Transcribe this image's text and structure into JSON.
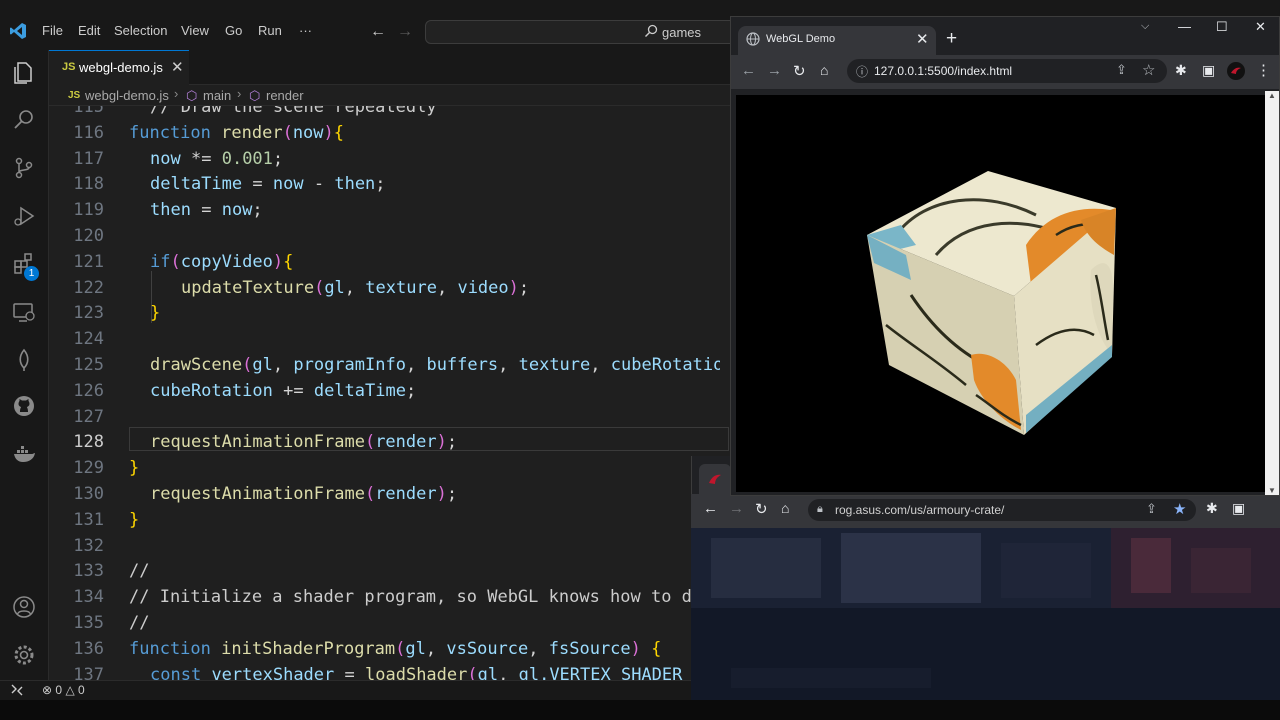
{
  "vscode": {
    "menu": [
      "File",
      "Edit",
      "Selection",
      "View",
      "Go",
      "Run",
      "···"
    ],
    "command_center": "games",
    "tab": {
      "icon_text": "JS",
      "label": "webgl-demo.js"
    },
    "breadcrumb": {
      "file": "webgl-demo.js",
      "symbol1": "main",
      "symbol2": "render"
    },
    "extensions_badge": "1",
    "lines": [
      {
        "n": "115",
        "code": "// Draw the scene repeatedly"
      },
      {
        "n": "116",
        "code": "function render(now){"
      },
      {
        "n": "117",
        "code": "now *= 0.001;"
      },
      {
        "n": "118",
        "code": "deltaTime = now - then;"
      },
      {
        "n": "119",
        "code": "then = now;"
      },
      {
        "n": "120",
        "code": ""
      },
      {
        "n": "121",
        "code": "if(copyVideo){"
      },
      {
        "n": "122",
        "code": "updateTexture(gl, texture, video);"
      },
      {
        "n": "123",
        "code": "}"
      },
      {
        "n": "124",
        "code": ""
      },
      {
        "n": "125",
        "code": "drawScene(gl, programInfo, buffers, texture, cubeRotation"
      },
      {
        "n": "126",
        "code": "cubeRotation += deltaTime;"
      },
      {
        "n": "127",
        "code": ""
      },
      {
        "n": "128",
        "code": "requestAnimationFrame(render);"
      },
      {
        "n": "129",
        "code": "}"
      },
      {
        "n": "130",
        "code": "requestAnimationFrame(render);"
      },
      {
        "n": "131",
        "code": "}"
      },
      {
        "n": "132",
        "code": ""
      },
      {
        "n": "133",
        "code": "//"
      },
      {
        "n": "134",
        "code": "// Initialize a shader program, so WebGL knows how to d"
      },
      {
        "n": "135",
        "code": "//"
      },
      {
        "n": "136",
        "code": "function initShaderProgram(gl, vsSource, fsSource) {"
      },
      {
        "n": "137",
        "code": "const vertexShader = loadShader(gl, gl.VERTEX_SHADER"
      }
    ],
    "status": {
      "errors": "0",
      "warnings": "0"
    }
  },
  "browser_front": {
    "tab_title": "WebGL Demo",
    "url": "127.0.0.1:5500/index.html"
  },
  "browser_back": {
    "url": "rog.asus.com/us/armoury-crate/"
  },
  "colors": {
    "accent": "#0078d4",
    "editor_bg": "#1f1f1f",
    "keyword": "#569cd6",
    "function": "#dcdcaa",
    "variable": "#9cdcfe",
    "number": "#b5cea8"
  }
}
